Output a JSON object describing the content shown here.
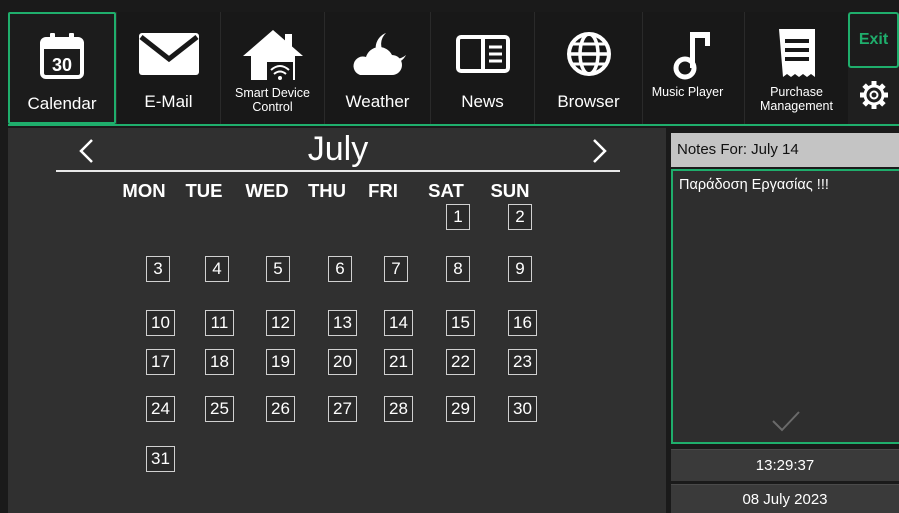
{
  "toolbar": {
    "items": [
      {
        "label": "Calendar",
        "icon": "calendar-icon",
        "icon_text": "30",
        "active": true
      },
      {
        "label": "E-Mail",
        "icon": "envelope-icon"
      },
      {
        "label": "Smart Device Control",
        "icon": "smart-home-icon"
      },
      {
        "label": "Weather",
        "icon": "cloud-moon-icon"
      },
      {
        "label": "News",
        "icon": "news-icon"
      },
      {
        "label": "Browser",
        "icon": "globe-icon"
      },
      {
        "label": "Music Player",
        "icon": "music-note-icon"
      },
      {
        "label": "Purchase Management",
        "icon": "receipt-icon"
      }
    ],
    "exit_label": "Exit",
    "settings_icon": "gear-icon",
    "accent_color": "#1fae6c"
  },
  "calendar": {
    "month": "July",
    "weekdays": [
      "MON",
      "TUE",
      "WED",
      "THU",
      "FRI",
      "SAT",
      "SUN"
    ],
    "days": [
      "1",
      "2",
      "3",
      "4",
      "5",
      "6",
      "7",
      "8",
      "9",
      "10",
      "11",
      "12",
      "13",
      "14",
      "15",
      "16",
      "17",
      "18",
      "19",
      "20",
      "21",
      "22",
      "23",
      "24",
      "25",
      "26",
      "27",
      "28",
      "29",
      "30",
      "31"
    ],
    "first_weekday_index": 5
  },
  "notes": {
    "header": "Notes For: July 14",
    "text": "Παράδοση Εργασίας !!!",
    "save_icon": "checkmark-icon"
  },
  "clock": {
    "time": "13:29:37",
    "date": "08 July 2023"
  }
}
